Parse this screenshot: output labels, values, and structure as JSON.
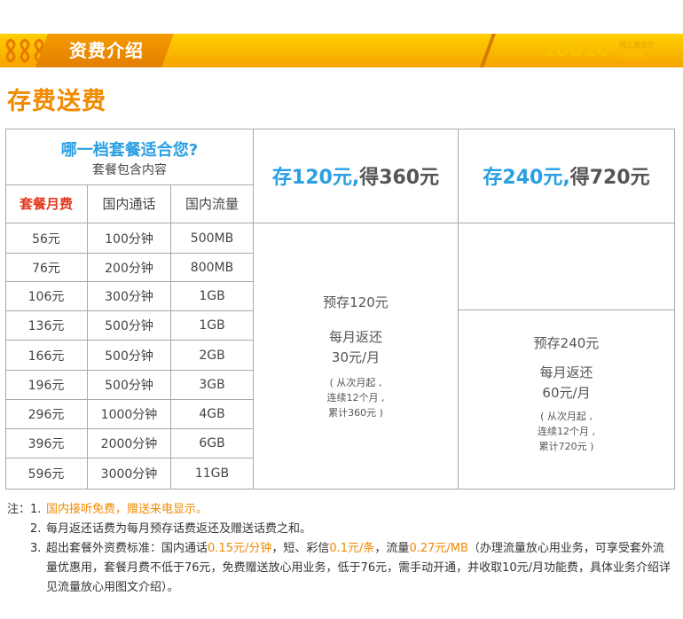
{
  "banner": {
    "title": "资费介绍",
    "brand": "10010",
    "brand_small": "网上营业厅",
    "brand_com": ".com"
  },
  "subtitle": "存费送费",
  "table": {
    "question": "哪一档套餐适合您?",
    "question_sub": "套餐包含内容",
    "headers": [
      "套餐月费",
      "国内通话",
      "国内流量"
    ],
    "rows": [
      [
        "56元",
        "100分钟",
        "500MB"
      ],
      [
        "76元",
        "200分钟",
        "800MB"
      ],
      [
        "106元",
        "300分钟",
        "1GB"
      ],
      [
        "136元",
        "500分钟",
        "1GB"
      ],
      [
        "166元",
        "500分钟",
        "2GB"
      ],
      [
        "196元",
        "500分钟",
        "3GB"
      ],
      [
        "296元",
        "1000分钟",
        "4GB"
      ],
      [
        "396元",
        "2000分钟",
        "6GB"
      ],
      [
        "596元",
        "3000分钟",
        "11GB"
      ]
    ],
    "offers": [
      {
        "cun": "存",
        "amount": "120元,",
        "de": " 得",
        "get": "360元",
        "deposit": "预存120元",
        "monthly_label": "每月返还",
        "monthly_value": "30元/月",
        "note1": "( 从次月起 ,",
        "note2": "连续12个月 ,",
        "note3": "累计360元 )"
      },
      {
        "cun": "存",
        "amount": "240元,",
        "de": "得",
        "get": "720元",
        "deposit": "预存240元",
        "monthly_label": "每月返还",
        "monthly_value": "60元/月",
        "note1": "( 从次月起 ,",
        "note2": "连续12个月 ,",
        "note3": "累计720元 )"
      }
    ]
  },
  "notes": {
    "lead": "注：",
    "n1_num": "1.",
    "n1_text": "国内接听免费，赠送来电显示。",
    "n2_num": "2.",
    "n2_text": "每月返还话费为每月预存话费返还及赠送话费之和。",
    "n3_num": "3.",
    "n3_a": "超出套餐外资费标准：国内通话",
    "n3_b": "0.15元/分钟",
    "n3_c": "，短、彩信",
    "n3_d": "0.1元/条",
    "n3_e": "，流量",
    "n3_f": "0.27元/MB",
    "n3_g": "（办理流量放心用业务，可享受套外流量优惠用，套餐月费不低于76元，免费赠送放心用业务，低于76元，需手动开通，并收取10元/月功能费，具体业务介绍详见流量放心用图文介绍）。"
  },
  "colors": {
    "banner": "#f5a400",
    "accent_orange": "#f08a00",
    "accent_blue": "#2a9fe2",
    "header_red": "#e23a1f"
  }
}
